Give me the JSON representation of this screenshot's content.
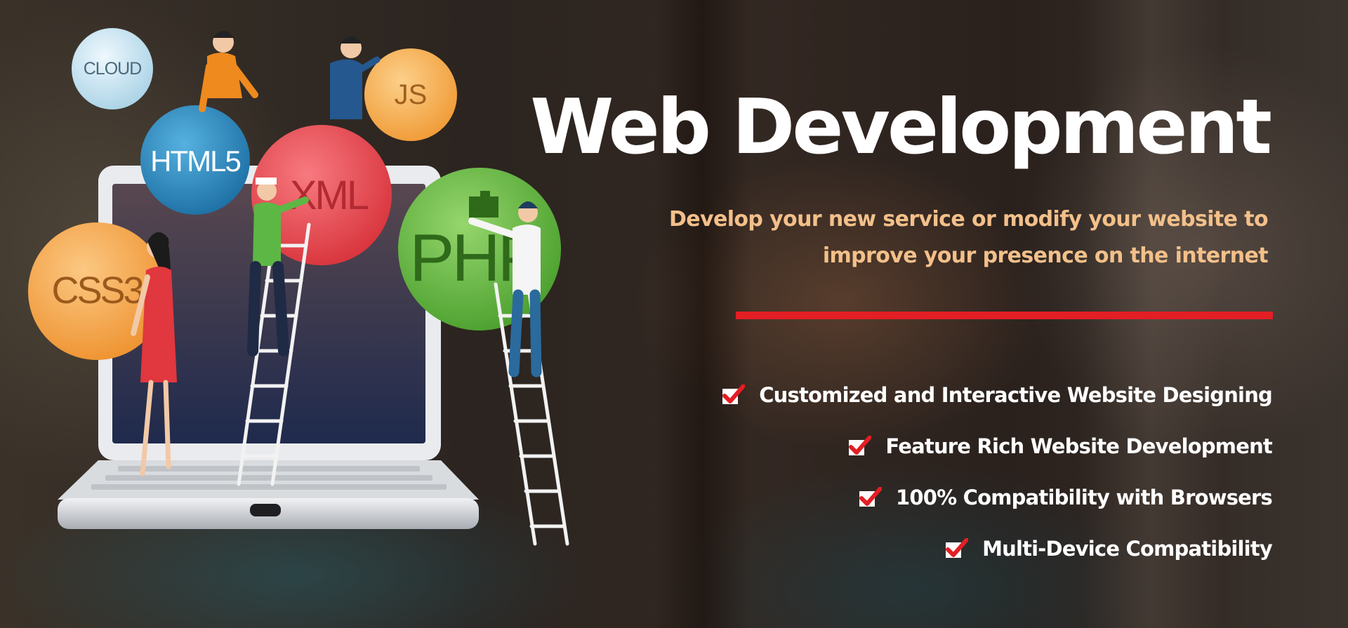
{
  "banner": {
    "title": "Web Development",
    "subtitle_lines": [
      "Develop your new service or modify your website to",
      "improve your presence on the internet"
    ],
    "accent_color": "#e31e24",
    "subtitle_color": "#f3c08a"
  },
  "features": [
    {
      "label": "Customized and Interactive Website Designing",
      "icon": "check-icon"
    },
    {
      "label": "Feature Rich Website Development",
      "icon": "check-icon"
    },
    {
      "label": "100% Compatibility with Browsers",
      "icon": "check-icon"
    },
    {
      "label": "Multi-Device Compatibility",
      "icon": "check-icon"
    }
  ],
  "illustration": {
    "bubbles": [
      {
        "label": "CLOUD",
        "color": "#cde6f2"
      },
      {
        "label": "JS",
        "color": "#f6b15a"
      },
      {
        "label": "HTML5",
        "color": "#2f8cc1"
      },
      {
        "label": "XML",
        "color": "#ea4a52"
      },
      {
        "label": "PHP",
        "color": "#6bbd45"
      },
      {
        "label": "CSS3",
        "color": "#f5a957"
      }
    ]
  }
}
